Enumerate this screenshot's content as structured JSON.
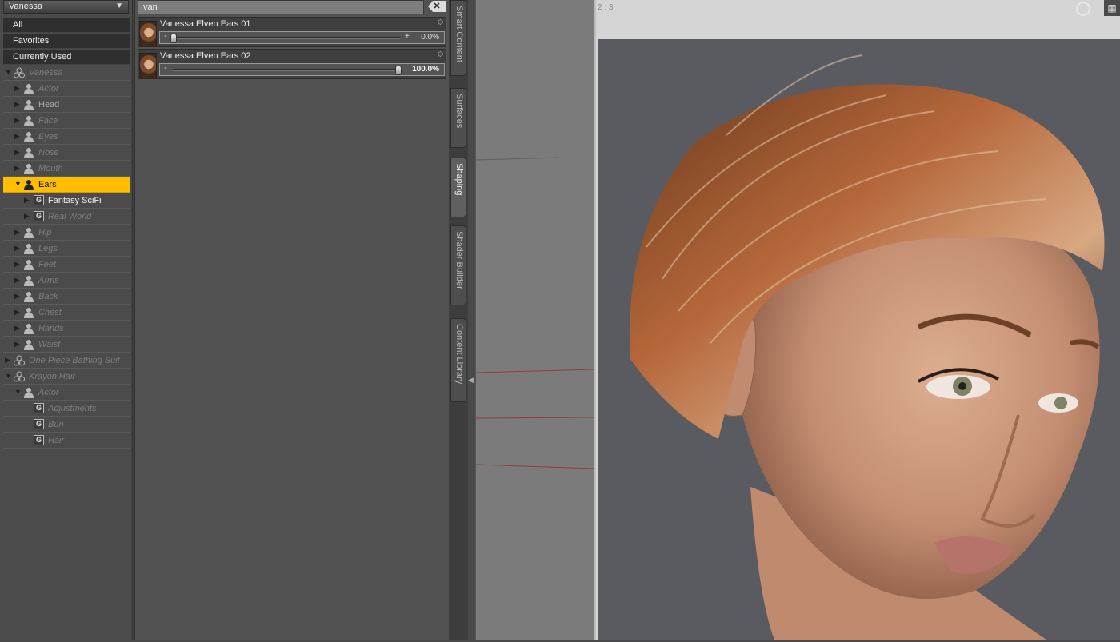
{
  "figure_selector": {
    "value": "Vanessa"
  },
  "filters": [
    "All",
    "Favorites",
    "Currently Used"
  ],
  "tree": [
    {
      "label": "Vanessa",
      "indent": 0,
      "twisty": "down",
      "icon": "figure-node-icon",
      "style": "dim"
    },
    {
      "label": "Actor",
      "indent": 1,
      "twisty": "right",
      "icon": "person-icon",
      "style": "dim"
    },
    {
      "label": "Head",
      "indent": 1,
      "twisty": "right",
      "icon": "person-icon",
      "style": "norm"
    },
    {
      "label": "Face",
      "indent": 1,
      "twisty": "right",
      "icon": "person-icon",
      "style": "dim"
    },
    {
      "label": "Eyes",
      "indent": 1,
      "twisty": "right",
      "icon": "person-icon",
      "style": "dim"
    },
    {
      "label": "Nose",
      "indent": 1,
      "twisty": "right",
      "icon": "person-icon",
      "style": "dim"
    },
    {
      "label": "Mouth",
      "indent": 1,
      "twisty": "right",
      "icon": "person-icon",
      "style": "dim"
    },
    {
      "label": "Ears",
      "indent": 1,
      "twisty": "down",
      "icon": "person-icon",
      "style": "selected"
    },
    {
      "label": "Fantasy SciFi",
      "indent": 2,
      "twisty": "right",
      "icon": "group-icon",
      "style": "bright"
    },
    {
      "label": "Real World",
      "indent": 2,
      "twisty": "right",
      "icon": "group-icon",
      "style": "dim"
    },
    {
      "label": "Hip",
      "indent": 1,
      "twisty": "right",
      "icon": "person-icon",
      "style": "dim"
    },
    {
      "label": "Legs",
      "indent": 1,
      "twisty": "right",
      "icon": "person-icon",
      "style": "dim"
    },
    {
      "label": "Feet",
      "indent": 1,
      "twisty": "right",
      "icon": "person-icon",
      "style": "dim"
    },
    {
      "label": "Arms",
      "indent": 1,
      "twisty": "right",
      "icon": "person-icon",
      "style": "dim"
    },
    {
      "label": "Back",
      "indent": 1,
      "twisty": "right",
      "icon": "person-icon",
      "style": "dim"
    },
    {
      "label": "Chest",
      "indent": 1,
      "twisty": "right",
      "icon": "person-icon",
      "style": "dim"
    },
    {
      "label": "Hands",
      "indent": 1,
      "twisty": "right",
      "icon": "person-icon",
      "style": "dim"
    },
    {
      "label": "Waist",
      "indent": 1,
      "twisty": "right",
      "icon": "person-icon",
      "style": "dim"
    },
    {
      "label": "One Piece Bathing Suit",
      "indent": 0,
      "twisty": "right",
      "icon": "figure-node-icon",
      "style": "dim"
    },
    {
      "label": "Krayon Hair",
      "indent": 0,
      "twisty": "down",
      "icon": "figure-node-icon",
      "style": "dim"
    },
    {
      "label": "Actor",
      "indent": 1,
      "twisty": "down",
      "icon": "person-icon",
      "style": "dim"
    },
    {
      "label": "Adjustments",
      "indent": 2,
      "twisty": "",
      "icon": "group-icon",
      "style": "dim"
    },
    {
      "label": "Bun",
      "indent": 2,
      "twisty": "",
      "icon": "group-icon",
      "style": "dim"
    },
    {
      "label": "Hair",
      "indent": 2,
      "twisty": "",
      "icon": "group-icon",
      "style": "dim"
    }
  ],
  "search": {
    "value": "van",
    "clear_label": "✕"
  },
  "morphs": [
    {
      "name": "Vanessa Elven Ears 01",
      "fraction": 0.0,
      "value_text": "0.0%",
      "bold": false
    },
    {
      "name": "Vanessa Elven Ears 02",
      "fraction": 1.0,
      "value_text": "100.0%",
      "bold": true
    }
  ],
  "side_tabs": [
    {
      "label": "Smart Content",
      "active": false
    },
    {
      "label": "Surfaces",
      "active": false
    },
    {
      "label": "Shaping",
      "active": true
    },
    {
      "label": "Shader Builder",
      "active": false
    },
    {
      "label": "Content Library",
      "active": false
    }
  ],
  "viewport": {
    "aspect": "2 : 3"
  },
  "colors": {
    "selection": "#ffbf00",
    "panel": "#4b4b4b",
    "render_bg": "#5a5b60"
  }
}
